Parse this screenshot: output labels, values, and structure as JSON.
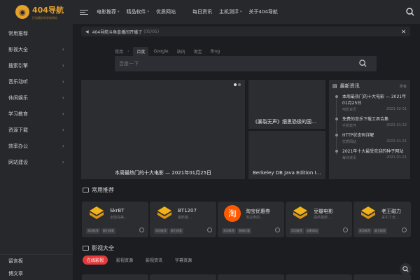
{
  "logo": {
    "title": "404导航",
    "subtitle": "打造最好的导航网站"
  },
  "sidebar": {
    "items": [
      {
        "label": "常用推荐",
        "chevron": false
      },
      {
        "label": "影视大全",
        "chevron": true
      },
      {
        "label": "搜索引擎",
        "chevron": true
      },
      {
        "label": "音乐动听",
        "chevron": true
      },
      {
        "label": "休闲娱乐",
        "chevron": true
      },
      {
        "label": "学习教育",
        "chevron": true
      },
      {
        "label": "资源下载",
        "chevron": true
      },
      {
        "label": "效率办公",
        "chevron": true
      },
      {
        "label": "网站建设",
        "chevron": true
      }
    ],
    "bottom": [
      {
        "label": "留言板"
      },
      {
        "label": "博文章"
      }
    ]
  },
  "header": {
    "nav": [
      "电影推荐",
      "精品软件",
      "优质网站",
      "每日资讯",
      "主机测评",
      "关于404导航"
    ]
  },
  "notice": {
    "text": "404导航斗鱼直播间开播了",
    "date": "(05/05)"
  },
  "search": {
    "label": "常用",
    "tabs": [
      "百度",
      "Google",
      "站内",
      "淘宝",
      "Bing"
    ],
    "active_tab": "百度",
    "placeholder": "百度一下"
  },
  "banner": {
    "main_caption": "本周最热门的十大电影 — 2021年01月25日",
    "side_top_caption": "《暴裂无声》细思恐极的国…",
    "side_bottom_caption": "Berkeley DB Java Edition In…"
  },
  "news": {
    "title": "最新资讯",
    "more": "所有",
    "items": [
      {
        "title": "本周最热门的十大电影 — 2021年01月25日",
        "category": "电影资讯",
        "date": "2021-02-01"
      },
      {
        "title": "免费的音乐下载工具合集",
        "category": "手机软件",
        "date": "2021-01-22"
      },
      {
        "title": "HTTP状态码详解",
        "category": "优质网站",
        "date": "2021-01-21"
      },
      {
        "title": "2021年十大最受欢迎的种子网站",
        "category": "每日资讯",
        "date": "2021-01-21"
      }
    ]
  },
  "sections": {
    "recommend_title": "常用推荐",
    "video_title": "影视大全"
  },
  "cards": [
    {
      "name": "SkrBT",
      "desc": "全能完美…",
      "icon": "box-icon",
      "tags": [
        "常用推荐",
        "磁力搜索"
      ]
    },
    {
      "name": "BT1207",
      "desc": "最新最…",
      "icon": "box-icon",
      "tags": [
        "常用推荐",
        "磁力搜索"
      ]
    },
    {
      "name": "淘宝优惠券",
      "desc": "淘宝券前…",
      "icon": "taobao-icon",
      "tags": [
        "常用推荐",
        "购物优惠"
      ]
    },
    {
      "name": "豆瓣电影",
      "desc": "提供最新…",
      "icon": "box-icon",
      "tags": [
        "常用推荐",
        "电影网站"
      ]
    },
    {
      "name": "老王磁力",
      "desc": "采引了全…",
      "icon": "box-icon",
      "tags": [
        "常用推荐",
        "磁力搜索"
      ]
    }
  ],
  "video_tabs": {
    "items": [
      "在线影视",
      "影视资源",
      "影视资讯",
      "字幕资源"
    ],
    "active": "在线影视"
  },
  "colors": {
    "accent": "#e5393b",
    "brand": "#e5a12b",
    "bg": "#1b1d21",
    "panel": "#2b2d31"
  }
}
